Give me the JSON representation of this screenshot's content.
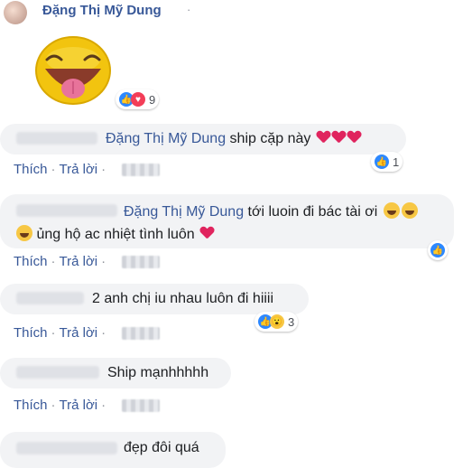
{
  "post": {
    "author_name": "Đặng Thị Mỹ Dung",
    "separator": "·",
    "sticker_name": "tongue-out-emoji-sticker",
    "reactions": {
      "icons": [
        "like-icon",
        "heart-icon"
      ],
      "count": "9"
    }
  },
  "actions": {
    "like": "Thích",
    "reply": "Trả lời",
    "dot": "·"
  },
  "comments": [
    {
      "tag": "Đặng Thị Mỹ Dung",
      "text": " ship cặp này",
      "emojis": [
        "heart",
        "heart",
        "heart"
      ],
      "reactions": {
        "icons": [
          "like-icon"
        ],
        "count": "1"
      }
    },
    {
      "tag": "Đặng Thị Mỹ Dung",
      "text": " tới luoin đi bác tài ơi",
      "emojis_line1": [
        "laugh",
        "laugh"
      ],
      "line2_text": " ủng hộ ac nhiệt tình luôn",
      "emojis_line2_pre": [
        "laugh"
      ],
      "emojis_line2_post": [
        "heart"
      ],
      "reactions": {
        "icons": [
          "like-icon"
        ],
        "count": ""
      }
    },
    {
      "text": "2 anh chị iu nhau luôn đi hiiii",
      "reactions": {
        "icons": [
          "like-icon",
          "wow-icon"
        ],
        "count": "3"
      }
    },
    {
      "text": "Ship mạnhhhhh"
    },
    {
      "text": "đẹp đôi quá"
    }
  ],
  "colors": {
    "link": "#385898",
    "bubble": "#f2f3f5",
    "like": "#2d88ff",
    "love": "#f33e58",
    "wow": "#f7c744"
  }
}
